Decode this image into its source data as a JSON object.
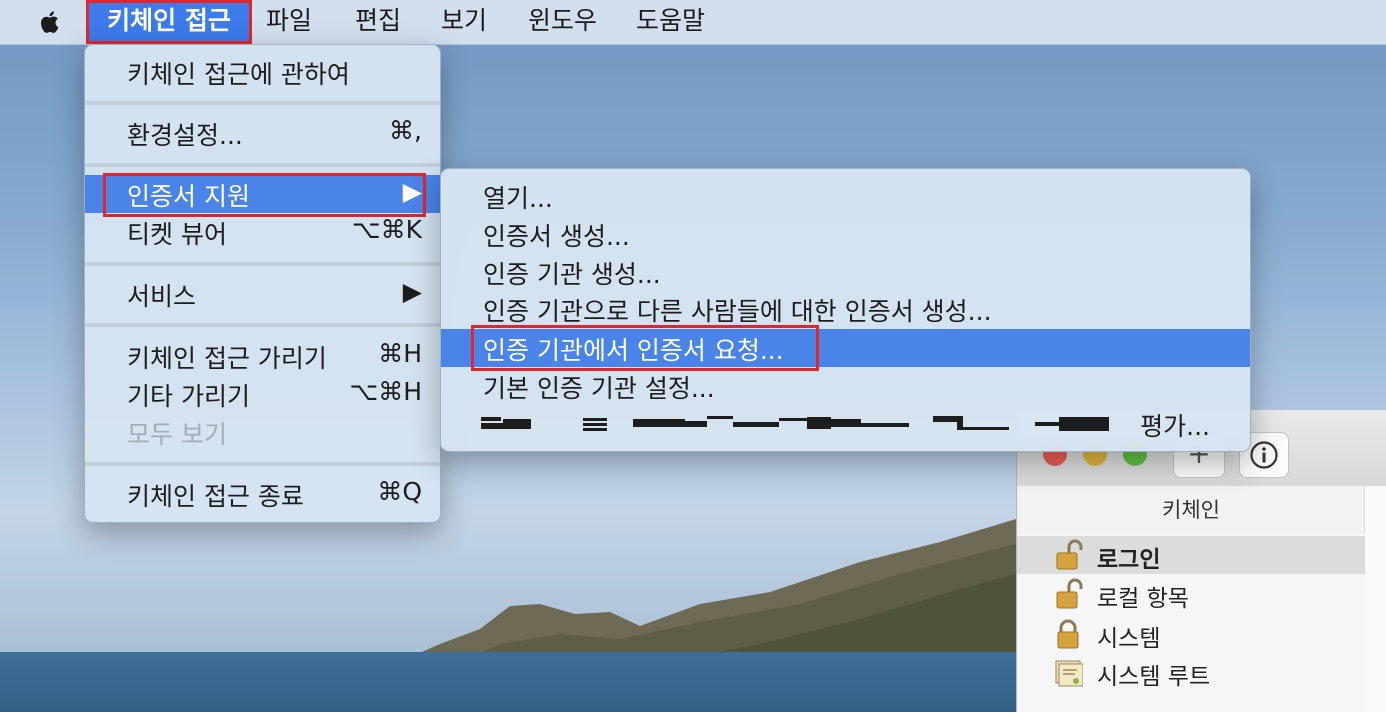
{
  "menubar": {
    "apple_icon": "apple-logo-icon",
    "app_menu": "키체인 접근",
    "items": [
      "파일",
      "편집",
      "보기",
      "윈도우",
      "도움말"
    ]
  },
  "app_menu": {
    "about": "키체인 접근에 관하여",
    "preferences": {
      "label": "환경설정...",
      "shortcut": "⌘,"
    },
    "cert_assistant": {
      "label": "인증서 지원",
      "arrow": "▶"
    },
    "ticket_viewer": {
      "label": "티켓 뷰어",
      "shortcut": "⌥⌘K"
    },
    "services": {
      "label": "서비스",
      "arrow": "▶"
    },
    "hide": {
      "label": "키체인 접근 가리기",
      "shortcut": "⌘H"
    },
    "hide_others": {
      "label": "기타 가리기",
      "shortcut": "⌥⌘H"
    },
    "show_all": {
      "label": "모두 보기"
    },
    "quit": {
      "label": "키체인 접근 종료",
      "shortcut": "⌘Q"
    }
  },
  "submenu": {
    "open": "열기...",
    "create_cert": "인증서 생성...",
    "create_ca": "인증 기관 생성...",
    "create_cert_for_others": "인증 기관으로 다른 사람들에 대한 인증서 생성...",
    "request_from_ca": "인증 기관에서 인증서 요청...",
    "set_default_ca": "기본 인증 기관 설정...",
    "evaluate": "평가..."
  },
  "keychain_window": {
    "add_label": "+",
    "info_icon": "info-icon",
    "header": "키체인",
    "items": [
      {
        "label": "로그인",
        "icon": "unlocked-padlock-icon",
        "selected": true
      },
      {
        "label": "로컬 항목",
        "icon": "unlocked-padlock-icon",
        "selected": false
      },
      {
        "label": "시스템",
        "icon": "locked-padlock-icon",
        "selected": false
      },
      {
        "label": "시스템 루트",
        "icon": "certificate-icon",
        "selected": false
      }
    ]
  },
  "colors": {
    "highlight": "#4a84e8",
    "annotation_red": "#e0262a",
    "traffic_close": "#ec5f57",
    "traffic_min": "#e4b63e",
    "traffic_max": "#5fc245"
  }
}
